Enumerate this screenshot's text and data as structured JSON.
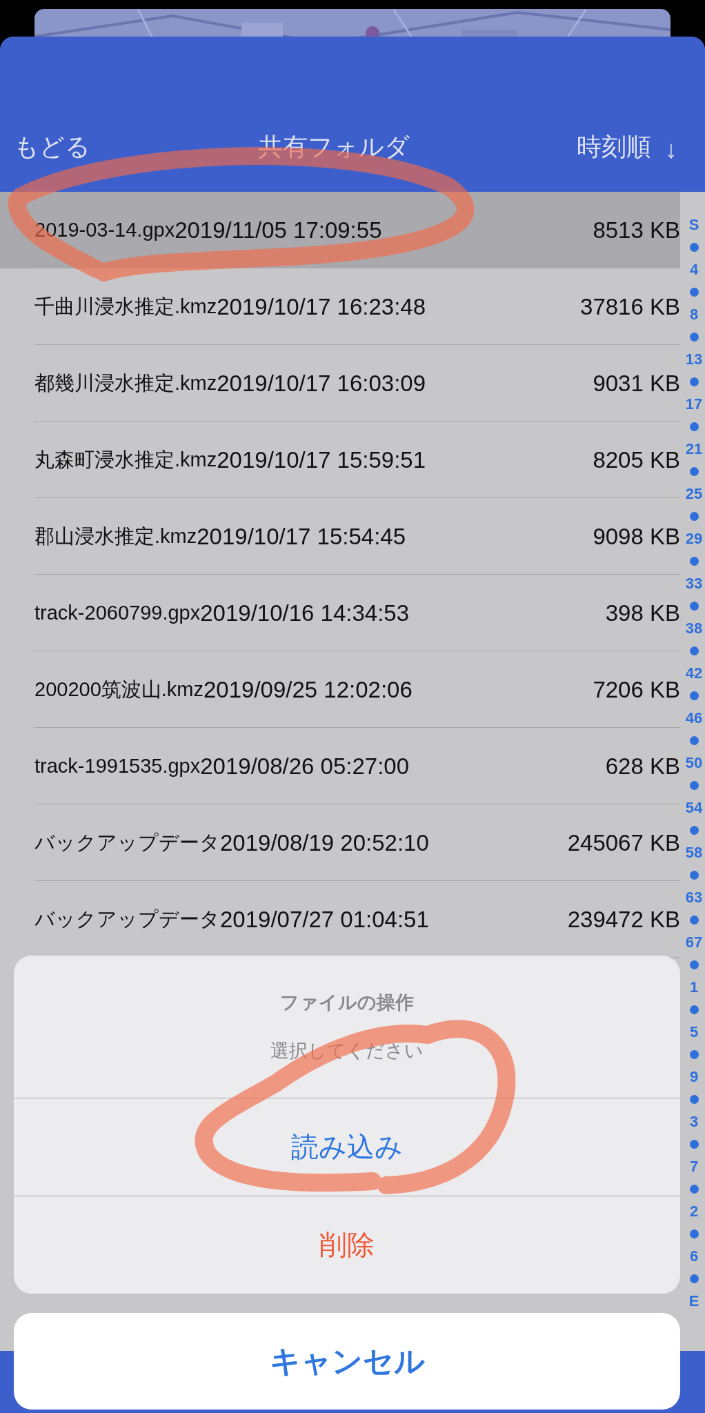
{
  "header": {
    "back": "もどる",
    "title": "共有フォルダ",
    "sort": "時刻順",
    "sort_arrow": "↓"
  },
  "files": [
    {
      "name": "2019-03-14.gpx",
      "date": "2019/11/05 17:09:55",
      "size": "8513 KB",
      "selected": true
    },
    {
      "name": "千曲川浸水推定.kmz",
      "date": "2019/10/17 16:23:48",
      "size": "37816 KB",
      "selected": false
    },
    {
      "name": "都幾川浸水推定.kmz",
      "date": "2019/10/17 16:03:09",
      "size": "9031 KB",
      "selected": false
    },
    {
      "name": "丸森町浸水推定.kmz",
      "date": "2019/10/17 15:59:51",
      "size": "8205 KB",
      "selected": false
    },
    {
      "name": "郡山浸水推定.kmz",
      "date": "2019/10/17 15:54:45",
      "size": "9098 KB",
      "selected": false
    },
    {
      "name": "track-2060799.gpx",
      "date": "2019/10/16 14:34:53",
      "size": "398 KB",
      "selected": false
    },
    {
      "name": "200200筑波山.kmz",
      "date": "2019/09/25 12:02:06",
      "size": "7206 KB",
      "selected": false
    },
    {
      "name": "track-1991535.gpx",
      "date": "2019/08/26 05:27:00",
      "size": "628 KB",
      "selected": false
    },
    {
      "name": "バックアップデータ",
      "date": "2019/08/19 20:52:10",
      "size": "245067 KB",
      "selected": false
    },
    {
      "name": "バックアップデータ",
      "date": "2019/07/27 01:04:51",
      "size": "239472 KB",
      "selected": false
    }
  ],
  "index": [
    "S",
    "4",
    "8",
    "13",
    "17",
    "21",
    "25",
    "29",
    "33",
    "38",
    "42",
    "46",
    "50",
    "54",
    "58",
    "63",
    "67",
    "1",
    "5",
    "9",
    "3",
    "7",
    "2",
    "6",
    "E"
  ],
  "action_sheet": {
    "title": "ファイルの操作",
    "message": "選択してください",
    "actions": [
      {
        "label": "読み込み",
        "kind": "default"
      },
      {
        "label": "削除",
        "kind": "destructive"
      }
    ],
    "cancel": "キャンセル"
  }
}
